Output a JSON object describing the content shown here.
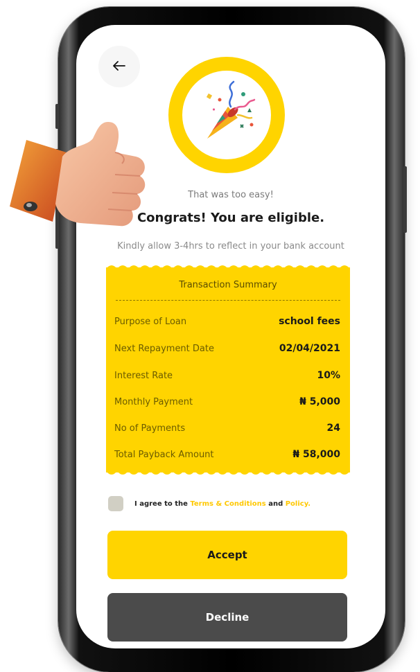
{
  "header": {
    "back_icon": "arrow-left-icon"
  },
  "hero": {
    "icon": "party-popper-icon",
    "ring_color": "#FFD400"
  },
  "messages": {
    "subtitle": "That was too easy!",
    "headline": "Congrats! You are eligible.",
    "note": "Kindly allow 3-4hrs to reflect in your bank account"
  },
  "summary": {
    "title": "Transaction Summary",
    "rows": [
      {
        "label": "Purpose of Loan",
        "value": "school fees"
      },
      {
        "label": "Next Repayment Date",
        "value": "02/04/2021"
      },
      {
        "label": "Interest Rate",
        "value": "10%"
      },
      {
        "label": "Monthly Payment",
        "value": "₦ 5,000"
      },
      {
        "label": "No of Payments",
        "value": "24"
      },
      {
        "label": "Total Payback Amount",
        "value": "₦ 58,000"
      }
    ]
  },
  "agreement": {
    "prefix": "I agree to the",
    "terms": "Terms & Conditions",
    "conjunction": "and",
    "policy": "Policy.",
    "checked": false
  },
  "actions": {
    "accept_label": "Accept",
    "decline_label": "Decline"
  },
  "colors": {
    "accent": "#FFD400",
    "link": "#FFC800",
    "decline_bg": "#4b4b4b"
  },
  "decoration": {
    "icon": "thumbs-up-icon"
  }
}
